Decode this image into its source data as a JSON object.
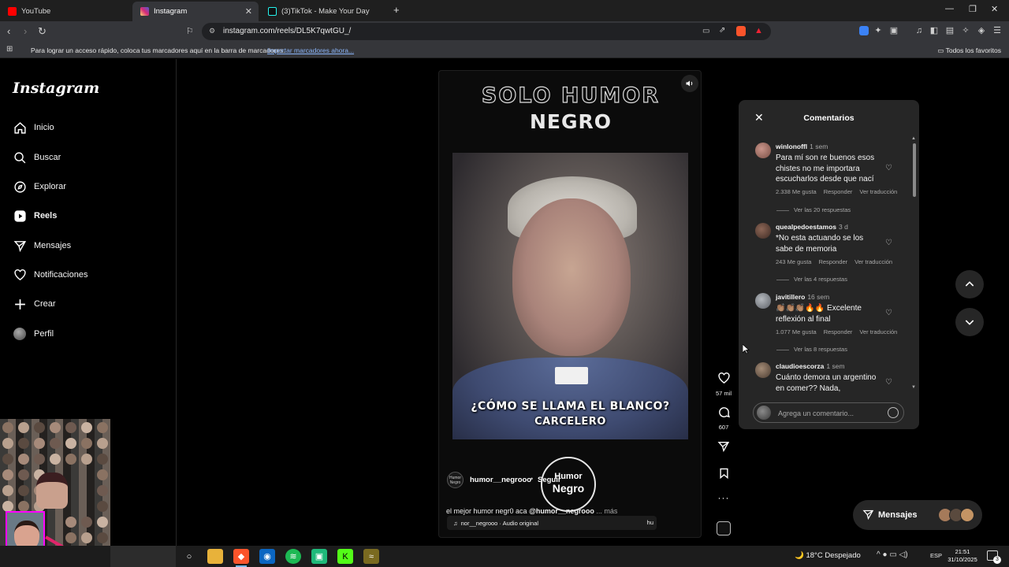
{
  "browser": {
    "tabs": [
      {
        "label": "YouTube",
        "color": "#ff0000"
      },
      {
        "label": "Instagram",
        "color": "#d62976"
      },
      {
        "label": "(3)TikTok - Make Your Day",
        "color": "#25f4ee"
      }
    ],
    "new_tab_label": "+",
    "url": "instagram.com/reels/DL5K7qwtGU_/",
    "bookmarks_hint": "Para lograr un acceso rápido, coloca tus marcadores aquí en la barra de marcadores.",
    "bookmarks_import": "Importar marcadores ahora...",
    "all_favorites": "Todos los favoritos"
  },
  "sidebar": {
    "logo": "Instagram",
    "items": [
      {
        "label": "Inicio",
        "icon": "home-icon"
      },
      {
        "label": "Buscar",
        "icon": "search-icon"
      },
      {
        "label": "Explorar",
        "icon": "compass-icon"
      },
      {
        "label": "Reels",
        "icon": "reels-icon"
      },
      {
        "label": "Mensajes",
        "icon": "messenger-icon"
      },
      {
        "label": "Notificaciones",
        "icon": "heart-icon"
      },
      {
        "label": "Crear",
        "icon": "plus-icon"
      },
      {
        "label": "Perfil",
        "icon": "profile-avatar"
      }
    ]
  },
  "reel": {
    "title_line1": "SOLO HUMOR",
    "title_line2": "NEGRO",
    "subtitle_line1": "¿CÓMO SE LLAMA EL BLANCO?",
    "subtitle_line2": "CARCELERO",
    "author": "humor__negrooo",
    "author_avatar_text": "Humor Negro",
    "dot": "•",
    "follow": "Seguir",
    "caption_text": "el mejor humor negr0 aca ",
    "caption_mention": "@humor__negrooo",
    "caption_more": " ... más",
    "audio": "nor__negrooo · Audio original",
    "audio_tail": "hu",
    "watermark_line1": "Humor",
    "watermark_line2": "Negro",
    "likes": "57 mil",
    "comments_count": "607"
  },
  "comments": {
    "title": "Comentarios",
    "input_placeholder": "Agrega un comentario...",
    "items": [
      {
        "user": "winlonoffl",
        "time": "1 sem",
        "text": "Para mí son re buenos esos chistes no me importara escucharlos desde que nací",
        "likes": "2.338 Me gusta",
        "reply": "Responder",
        "translate": "Ver traducción",
        "replies": "Ver las 20 respuestas",
        "avatar_color": "#b07a66"
      },
      {
        "user": "quealpedoestamos",
        "time": "3 d",
        "text": "*No esta actuando se los sabe de memoria",
        "likes": "243 Me gusta",
        "reply": "Responder",
        "translate": "Ver traducción",
        "replies": "Ver las 4 respuestas",
        "avatar_color": "#6b4a3e"
      },
      {
        "user": "javitillero",
        "time": "16 sem",
        "text": "👏🏽👏🏽👏🏽🔥🔥 Excelente reflexión al final",
        "likes": "1.077 Me gusta",
        "reply": "Responder",
        "translate": "Ver traducción",
        "replies": "Ver las 8 respuestas",
        "avatar_color": "#8a8f96"
      },
      {
        "user": "claudioescorza",
        "time": "1 sem",
        "text": "Cuánto demora un argentino en comer?? Nada,",
        "avatar_color": "#7d6a5a"
      }
    ]
  },
  "messages_button": "Mensajes",
  "taskbar": {
    "weather": "18°C  Despejado",
    "lang": "ESP",
    "time": "21:51",
    "date": "31/10/2025",
    "notif_count": "3"
  }
}
